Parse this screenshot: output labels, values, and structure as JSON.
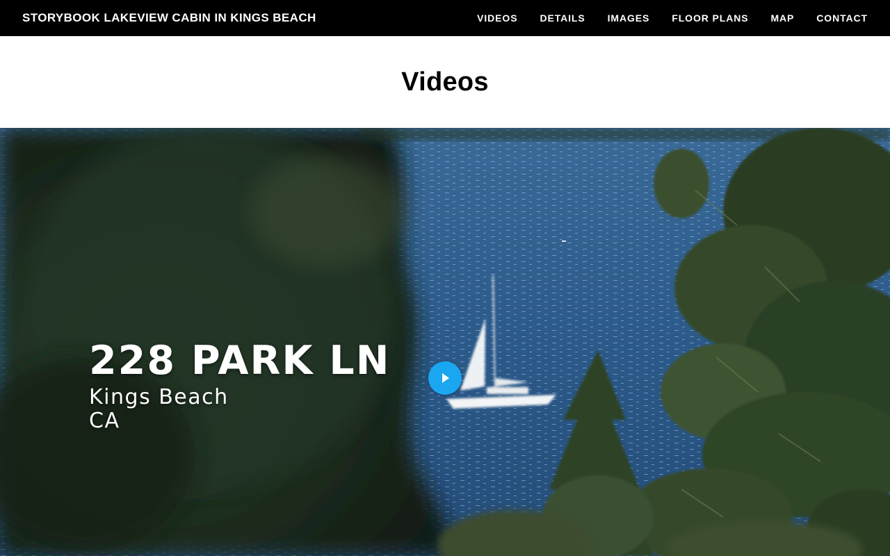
{
  "header": {
    "site_title": "STORYBOOK LAKEVIEW CABIN IN KINGS BEACH",
    "nav": [
      "VIDEOS",
      "DETAILS",
      "IMAGES",
      "FLOOR PLANS",
      "MAP",
      "CONTACT"
    ]
  },
  "main": {
    "title": "Videos"
  },
  "video": {
    "address": "228 PARK LN",
    "city": "Kings Beach",
    "state": "CA",
    "play_icon": "play-icon",
    "colors": {
      "play_button": "#1aa6f0",
      "lake": "#2a5a8c",
      "trees": "#1f3524"
    }
  }
}
